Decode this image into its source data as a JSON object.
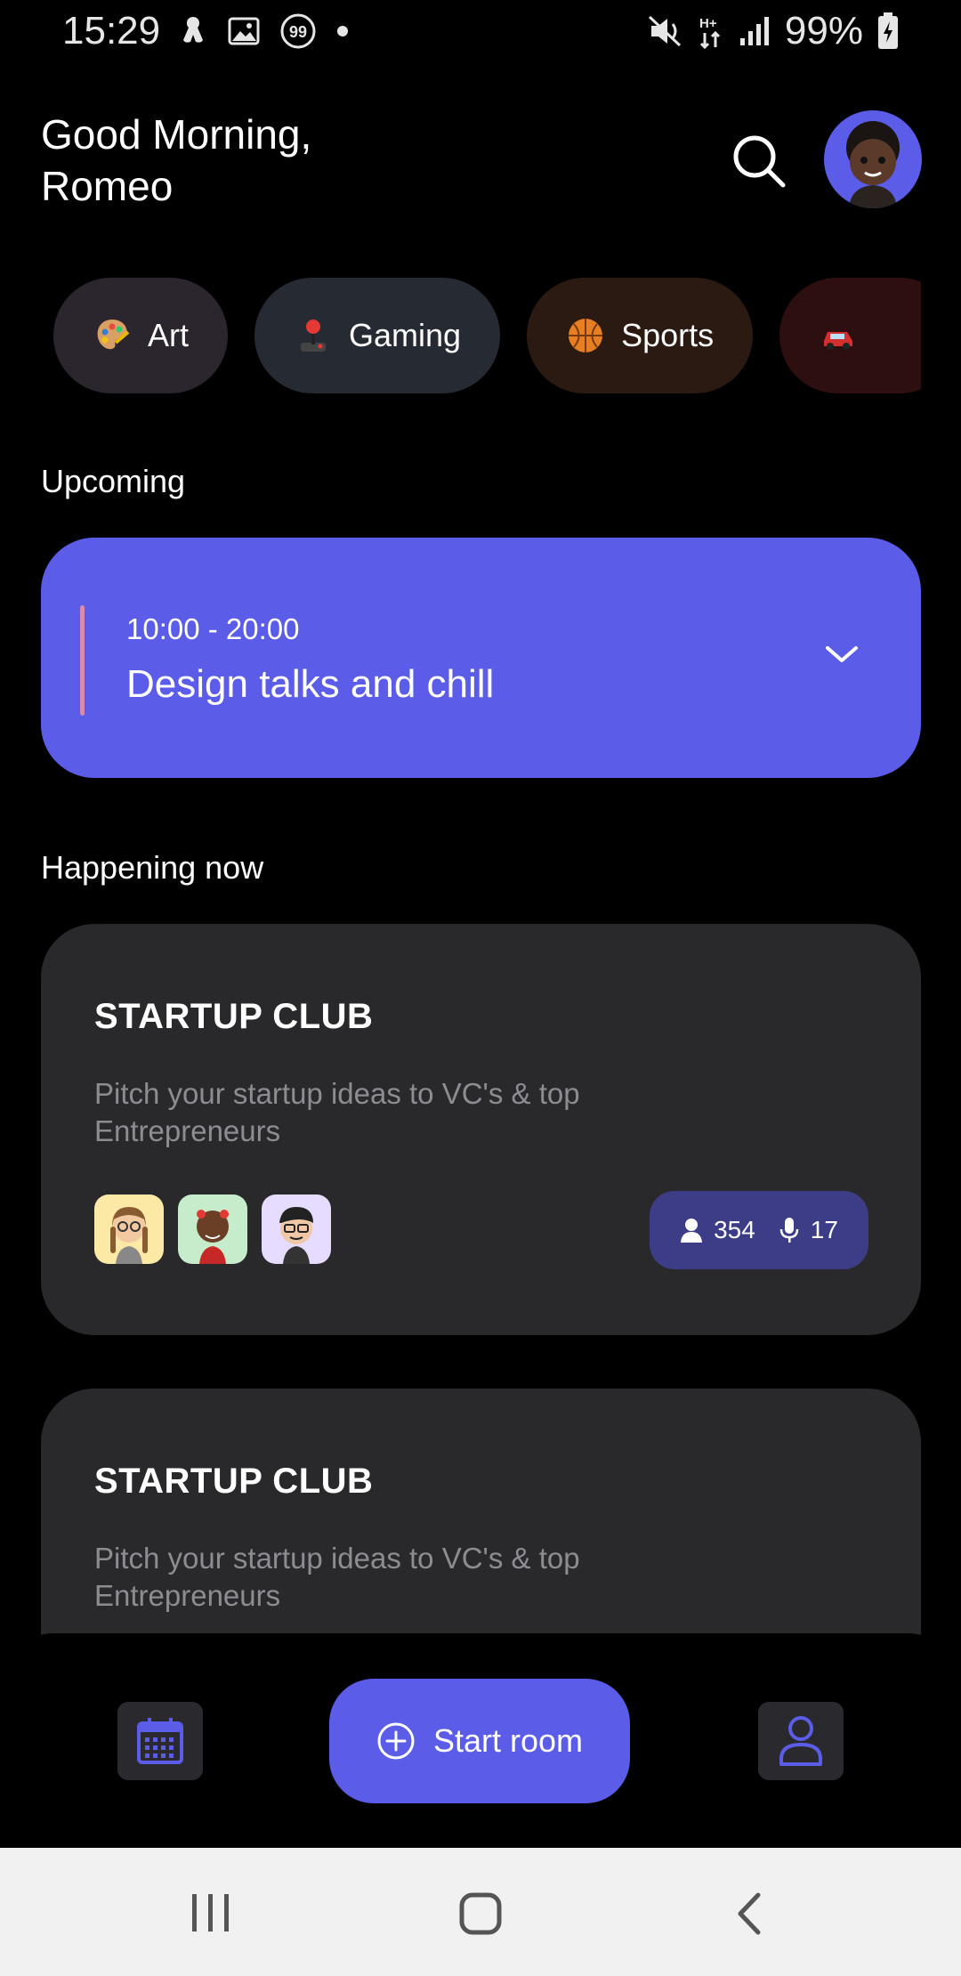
{
  "status_bar": {
    "time": "15:29",
    "battery": "99%",
    "icons": [
      "notification-icon",
      "gallery-icon",
      "badge-99-icon",
      "dot-icon",
      "mute-icon",
      "data-icon",
      "signal-icon",
      "battery-icon"
    ],
    "badge_number": "99"
  },
  "header": {
    "greeting_line1": "Good Morning,",
    "greeting_line2": "Romeo",
    "search_icon": "search-icon",
    "avatar_icon": "memoji-avatar"
  },
  "categories": [
    {
      "label": "Art",
      "emoji": "palette",
      "bg": "#2b252e"
    },
    {
      "label": "Gaming",
      "emoji": "joystick",
      "bg": "#262a33"
    },
    {
      "label": "Sports",
      "emoji": "basketball",
      "bg": "#2a1a12"
    },
    {
      "label": "",
      "emoji": "car",
      "bg": "#2e0f10"
    }
  ],
  "upcoming": {
    "section_title": "Upcoming",
    "time_range": "10:00 - 20:00",
    "title": "Design talks and chill"
  },
  "happening_now": {
    "section_title": "Happening now",
    "rooms": [
      {
        "title": "STARTUP CLUB",
        "description": "Pitch your startup ideas to VC's & top Entrepreneurs",
        "listeners": "354",
        "speakers": "17",
        "faces": [
          "#fde9a6",
          "#c6eccc",
          "#e6dcff"
        ]
      },
      {
        "title": "STARTUP CLUB",
        "description": "Pitch your startup ideas to VC's & top Entrepreneurs"
      }
    ]
  },
  "actions": {
    "start_room_label": "Start room"
  },
  "colors": {
    "accent": "#5b5de8",
    "card": "#29292c",
    "stats_bg": "#3c3d86"
  }
}
